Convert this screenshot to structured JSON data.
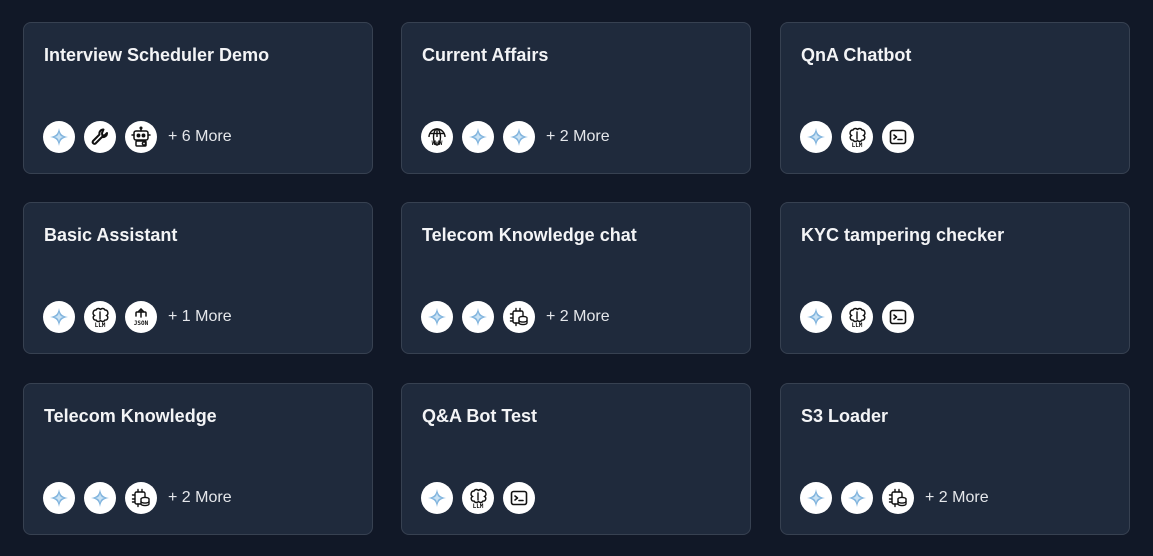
{
  "cards": [
    {
      "title": "Interview Scheduler Demo",
      "icons": [
        "sparkle-icon",
        "wrench-icon",
        "robot-icon"
      ],
      "more": "+ 6 More"
    },
    {
      "title": "Current Affairs",
      "icons": [
        "globe-www-icon",
        "sparkle-icon",
        "sparkle-icon"
      ],
      "more": "+ 2 More"
    },
    {
      "title": "QnA Chatbot",
      "icons": [
        "sparkle-icon",
        "llm-icon",
        "terminal-icon"
      ],
      "more": ""
    },
    {
      "title": "Basic Assistant",
      "icons": [
        "sparkle-icon",
        "llm-icon",
        "json-icon"
      ],
      "more": "+ 1 More"
    },
    {
      "title": "Telecom Knowledge chat",
      "icons": [
        "sparkle-icon",
        "sparkle-icon",
        "chip-database-icon"
      ],
      "more": "+ 2 More"
    },
    {
      "title": "KYC tampering checker",
      "icons": [
        "sparkle-icon",
        "llm-icon",
        "terminal-icon"
      ],
      "more": ""
    },
    {
      "title": "Telecom Knowledge",
      "icons": [
        "sparkle-icon",
        "sparkle-icon",
        "chip-database-icon"
      ],
      "more": "+ 2 More"
    },
    {
      "title": "Q&A Bot Test",
      "icons": [
        "sparkle-icon",
        "llm-icon",
        "terminal-icon"
      ],
      "more": ""
    },
    {
      "title": "S3 Loader",
      "icons": [
        "sparkle-icon",
        "sparkle-icon",
        "chip-database-icon"
      ],
      "more": "+ 2 More"
    }
  ],
  "colors": {
    "page_background": "#111827",
    "card_background": "#1f2a3c",
    "card_border": "#374151",
    "title_text": "#f3f4f6",
    "icon_background": "#ffffff",
    "sparkle_accent": "#7fb3dd"
  }
}
